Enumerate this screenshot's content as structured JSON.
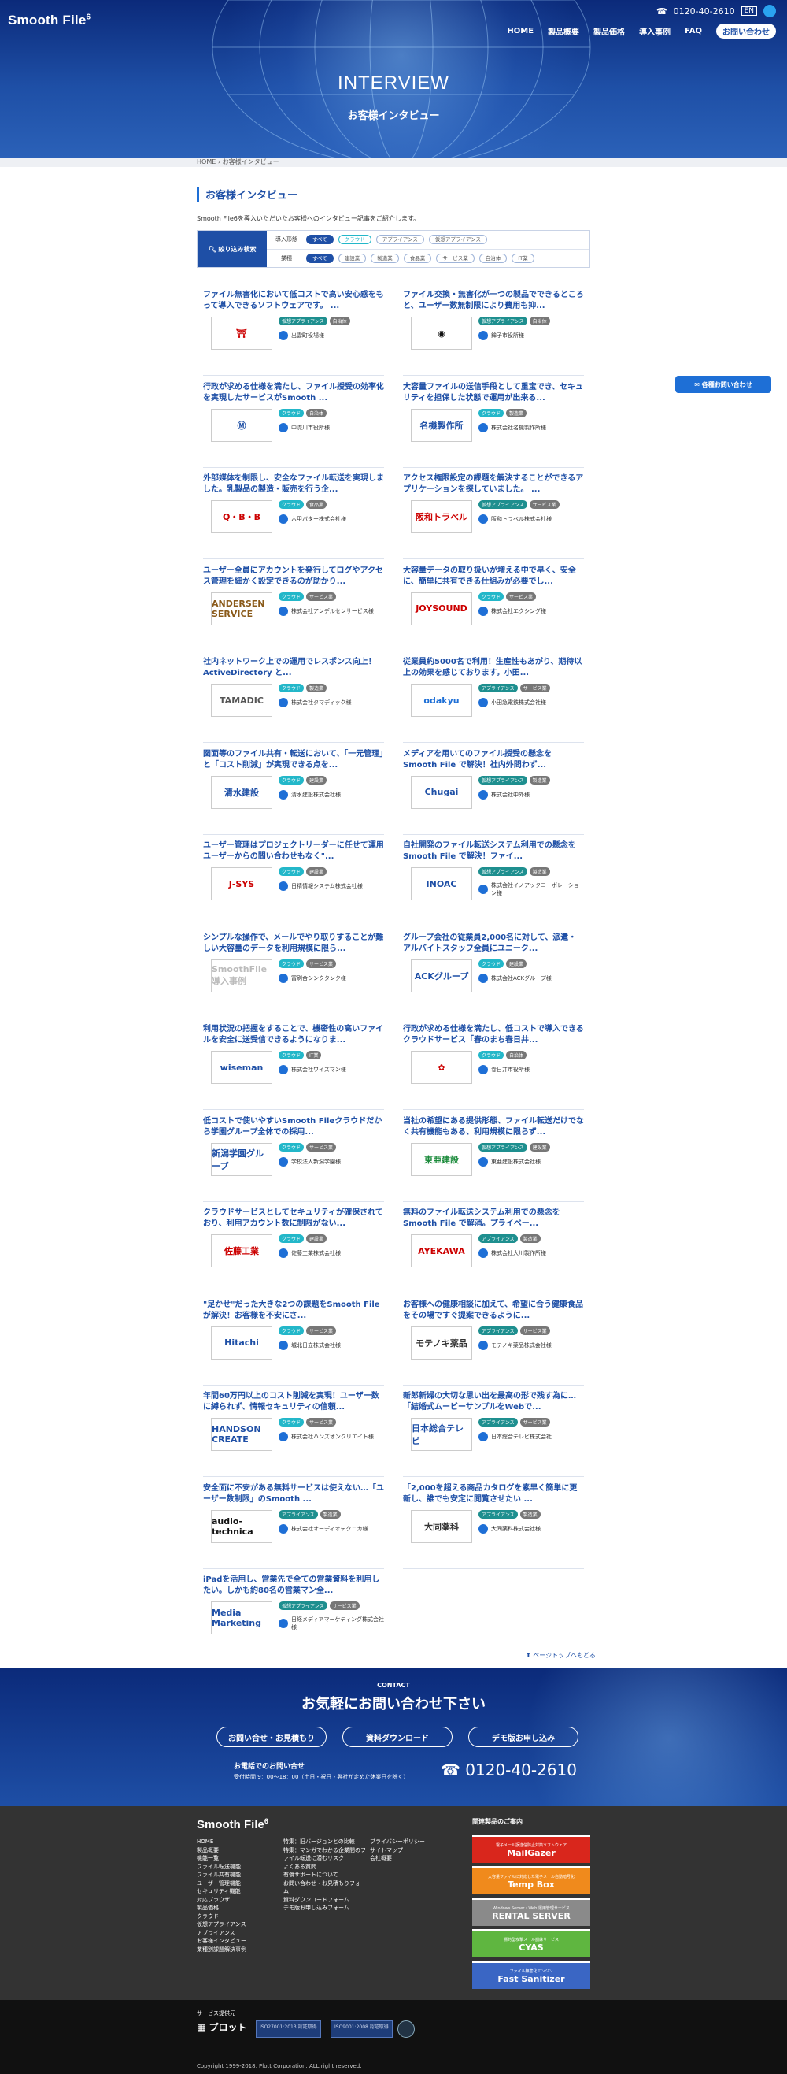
{
  "header": {
    "logo": "Smooth File",
    "logo_ver": "6",
    "phone": "0120-40-2610",
    "lang": "EN",
    "nav": [
      "HOME",
      "製品概要",
      "製品価格",
      "導入事例",
      "FAQ"
    ],
    "nav_cta": "お問い合わせ"
  },
  "hero": {
    "title": "INTERVIEW",
    "subtitle": "お客様インタビュー"
  },
  "breadcrumb": {
    "home": "HOME",
    "current": "お客様インタビュー"
  },
  "section": {
    "title": "お客様インタビュー",
    "lead": "Smooth File6を導入いただいたお客様へのインタビュー記事をご紹介します。"
  },
  "filter": {
    "head": "絞り込み検索",
    "rows": [
      {
        "label": "導入形態",
        "chips": [
          "すべて",
          "クラウド",
          "アプライアンス",
          "仮想アプライアンス"
        ]
      },
      {
        "label": "業種",
        "chips": [
          "すべて",
          "建設業",
          "製造業",
          "食品業",
          "サービス業",
          "自治体",
          "IT業"
        ]
      }
    ]
  },
  "float_cta": "各種お問い合わせ",
  "cards": [
    {
      "title": "ファイル無害化において低コストで高い安心感をもって導入できるソフトウェアです。 ...",
      "tags": [
        "仮想アプライアンス",
        "自治体"
      ],
      "company": "出雲町役場様",
      "logo": "⛩",
      "color": "#c00"
    },
    {
      "title": "ファイル交換・無害化が一つの製品でできるところと、ユーザー数無制限により費用も抑...",
      "tags": [
        "仮想アプライアンス",
        "自治体"
      ],
      "company": "鉾子市役所様",
      "logo": "◉",
      "color": "#111"
    },
    {
      "title": "行政が求める仕様を満たし、ファイル授受の効率化を実現したサービスがSmooth ...",
      "tags": [
        "クラウド",
        "自治体"
      ],
      "company": "中流川市役所様",
      "logo": "Ⓜ",
      "color": "#1e4fa6"
    },
    {
      "title": "大容量ファイルの送信手段として重宝でき、セキュリティを担保した状態で運用が出来る...",
      "tags": [
        "クラウド",
        "製造業"
      ],
      "company": "株式会社名機製作所様",
      "logo": "名機製作所",
      "color": "#1e4fa6"
    },
    {
      "title": "外部媒体を制限し、安全なファイル転送を実現しました。乳製品の製造・販売を行う企...",
      "tags": [
        "クラウド",
        "食品業"
      ],
      "company": "六甲バター株式会社様",
      "logo": "Q・B・B",
      "color": "#c00"
    },
    {
      "title": "アクセス権限設定の課題を解決することができるアプリケーションを探していました。 ...",
      "tags": [
        "仮想アプライアンス",
        "サービス業"
      ],
      "company": "阪和トラベル株式会社様",
      "logo": "阪和トラベル",
      "color": "#c00"
    },
    {
      "title": "ユーザー全員にアカウントを発行してログやアクセス管理を細かく設定できるのが助かり...",
      "tags": [
        "クラウド",
        "サービス業"
      ],
      "company": "株式会社アンデルセンサービス様",
      "logo": "ANDERSEN SERVICE",
      "color": "#8a5a1a"
    },
    {
      "title": "大容量データの取り扱いが増える中で早く、安全に、簡単に共有できる仕組みが必要でし...",
      "tags": [
        "クラウド",
        "サービス業"
      ],
      "company": "株式会社エクシング様",
      "logo": "JOYSOUND",
      "color": "#c00"
    },
    {
      "title": "社内ネットワーク上での運用でレスポンス向上！ActiveDirectory と...",
      "tags": [
        "クラウド",
        "製造業"
      ],
      "company": "株式会社タマディック様",
      "logo": "TAMADIC",
      "color": "#555"
    },
    {
      "title": "従業員約5000名で利用！生産性もあがり、期待以上の効果を感じております。小田...",
      "tags": [
        "アプライアンス",
        "サービス業"
      ],
      "company": "小田急電鉄株式会社様",
      "logo": "odakyu",
      "color": "#1e6fd6"
    },
    {
      "title": "図面等のファイル共有・転送において、「一元管理」と「コスト削減」が実現できる点を...",
      "tags": [
        "クラウド",
        "建設業"
      ],
      "company": "清水建設株式会社様",
      "logo": "清水建設",
      "color": "#1e4fa6"
    },
    {
      "title": "メディアを用いてのファイル授受の懸念をSmooth File で解決！社内外問わず...",
      "tags": [
        "仮想アプライアンス",
        "製造業"
      ],
      "company": "株式会社中外様",
      "logo": "Chugai",
      "color": "#1e4fa6"
    },
    {
      "title": "ユーザー管理はプロジェクトリーダーに任せて運用 ユーザーからの問い合わせもなく\"...",
      "tags": [
        "クラウド",
        "建設業"
      ],
      "company": "日精情報システム株式会社様",
      "logo": "J-SYS",
      "color": "#c00"
    },
    {
      "title": "自社開発のファイル転送システム利用での懸念をSmooth File で解決！ファイ...",
      "tags": [
        "仮想アプライアンス",
        "製造業"
      ],
      "company": "株式会社イノアックコーポレーション様",
      "logo": "INOAC",
      "color": "#1e4fa6"
    },
    {
      "title": "シンプルな操作で、メールでやり取りすることが難しい大容量のデータを利用規模に限ら...",
      "tags": [
        "クラウド",
        "サービス業"
      ],
      "company": "富刷合シンクタンク様",
      "logo": "SmoothFile 導入事例",
      "color": "#bbb"
    },
    {
      "title": "グループ会社の従業員2,000名に対して、派遣・アルバイトスタッフ全員にユニーク...",
      "tags": [
        "クラウド",
        "建設業"
      ],
      "company": "株式会社ACKグループ様",
      "logo": "ACKグループ",
      "color": "#1e4fa6"
    },
    {
      "title": "利用状況の把握をすることで、機密性の高いファイルを安全に送受信できるようになりま...",
      "tags": [
        "クラウド",
        "IT業"
      ],
      "company": "株式会社ワイズマン様",
      "logo": "wiseman",
      "color": "#1e4fa6"
    },
    {
      "title": "行政が求める仕様を満たし、低コストで導入できるクラウドサービス「春のまち春日井...",
      "tags": [
        "クラウド",
        "自治体"
      ],
      "company": "春日井市役所様",
      "logo": "✿",
      "color": "#c00"
    },
    {
      "title": "低コストで使いやすいSmooth Fileクラウドだから学園グループ全体での採用...",
      "tags": [
        "クラウド",
        "サービス業"
      ],
      "company": "学校法人新潟学園様",
      "logo": "新潟学園グループ",
      "color": "#1e4fa6"
    },
    {
      "title": "当社の希望にある提供形態、ファイル転送だけでなく共有機能もある、利用規模に限らず...",
      "tags": [
        "仮想アプライアンス",
        "建設業"
      ],
      "company": "東亜建設株式会社様",
      "logo": "東亜建設",
      "color": "#1a8a3a"
    },
    {
      "title": "クラウドサービスとしてセキュリティが確保されており、利用アカウント数に制限がない...",
      "tags": [
        "クラウド",
        "建設業"
      ],
      "company": "佐藤工業株式会社様",
      "logo": "佐藤工業",
      "color": "#c00"
    },
    {
      "title": "無料のファイル転送システム利用での懸念をSmooth File で解消。プライベー...",
      "tags": [
        "アプライアンス",
        "製造業"
      ],
      "company": "株式会社大川製作所様",
      "logo": "AYEKAWA",
      "color": "#c00"
    },
    {
      "title": "\"足かせ\"だった大きな2つの課題をSmooth File が解決！お客様を不安にさ...",
      "tags": [
        "クラウド",
        "サービス業"
      ],
      "company": "城北日立株式会社様",
      "logo": "Hitachi",
      "color": "#1e4fa6"
    },
    {
      "title": "お客様への健康相談に加えて、希望に合う健康食品をその場ですぐ提案できるように...",
      "tags": [
        "アプライアンス",
        "サービス業"
      ],
      "company": "モテノキ薬品株式会社様",
      "logo": "モテノキ薬品",
      "color": "#333"
    },
    {
      "title": "年間60万円以上のコスト削減を実現！ユーザー数に縛られず、情報セキュリティの信頼...",
      "tags": [
        "クラウド",
        "サービス業"
      ],
      "company": "株式会社ハンズオンクリエイト様",
      "logo": "HANDSON CREATE",
      "color": "#1e4fa6"
    },
    {
      "title": "新郎新婦の大切な思い出を最高の形で残す為に…「結婚式ムービーサンプルをWebで...",
      "tags": [
        "アプライアンス",
        "サービス業"
      ],
      "company": "日本総合テレビ株式会社",
      "logo": "日本総合テレビ",
      "color": "#1e4fa6"
    },
    {
      "title": "安全面に不安がある無料サービスは使えない…「ユーザー数制限」のSmooth ...",
      "tags": [
        "アプライアンス",
        "製造業"
      ],
      "company": "株式会社オーディオテクニカ様",
      "logo": "audio-technica",
      "color": "#111"
    },
    {
      "title": "「2,000を超える商品カタログを素早く簡単に更新し、誰でも安定に閲覧させたい ...",
      "tags": [
        "アプライアンス",
        "製造業"
      ],
      "company": "大同薬科株式会社様",
      "logo": "大同薬科",
      "color": "#333"
    },
    {
      "title": "iPadを活用し、営業先で全ての営業資料を利用したい。しかも約80名の営業マン全...",
      "tags": [
        "仮想アプライアンス",
        "サービス業"
      ],
      "company": "日経メディアマーケティング株式会社様",
      "logo": "Media Marketing",
      "color": "#1e4fa6"
    }
  ],
  "pagetop": "ページトップへもどる",
  "contact": {
    "label": "CONTACT",
    "heading": "お気軽にお問い合わせ下さい",
    "buttons": [
      "お問い合せ・お見積もり",
      "資料ダウンロード",
      "デモ版お申し込み"
    ],
    "tel_label": "お電話でのお問い合せ",
    "tel_hours": "受付時間 9：00〜18：00（土日・祝日・弊社が定めた休業日を除く）",
    "tel": "0120-40-2610"
  },
  "footer": {
    "logo": "Smooth File",
    "logo_ver": "6",
    "col1": [
      "HOME",
      "製品概要",
      "機能一覧",
      "ファイル転送機能",
      "ファイル共有機能",
      "ユーザー管理機能",
      "セキュリティ機能",
      "対応ブラウザ",
      "製品価格",
      "クラウド",
      "仮想アプライアンス",
      "アプライアンス",
      "お客様インタビュー",
      "業種別課題解決事例"
    ],
    "col2": [
      "特集：旧バージョンとの比較",
      "特集：マンガでわかる企業間のファイル転送に潜むリスク",
      "よくある質問",
      "有償サポートについて",
      "お問い合わせ・お見積もりフォーム",
      "資料ダウンロードフォーム",
      "デモ版お申し込みフォーム"
    ],
    "col3": [
      "プライバシーポリシー",
      "サイトマップ",
      "会社概要"
    ],
    "related_title": "関連製品のご案内",
    "related": [
      {
        "sub": "電子メール誤送信防止対策ソフトウェア",
        "name": "MailGazer",
        "color": "#d9261c"
      },
      {
        "sub": "大容量ファイルに対応した電子メール自動暗号化",
        "name": "Temp Box",
        "color": "#f08a1c"
      },
      {
        "sub": "Windows Server・Web 運用管理サービス",
        "name": "RENTAL SERVER",
        "color": "#8a8a8a"
      },
      {
        "sub": "標的型攻撃メール訓練サービス",
        "name": "CYAS",
        "color": "#5fb640"
      },
      {
        "sub": "ファイル無害化エンジン",
        "name": "Fast Sanitizer",
        "color": "#3a66c4"
      }
    ]
  },
  "bottom": {
    "operator": "サービス提供元",
    "company": "プロット",
    "certs": [
      "ISO27001:2013 認証取得",
      "ISO9001:2008 認証取得"
    ],
    "copyright": "Copyright 1999-2018, Plott Corporation. ALL right reserved."
  }
}
